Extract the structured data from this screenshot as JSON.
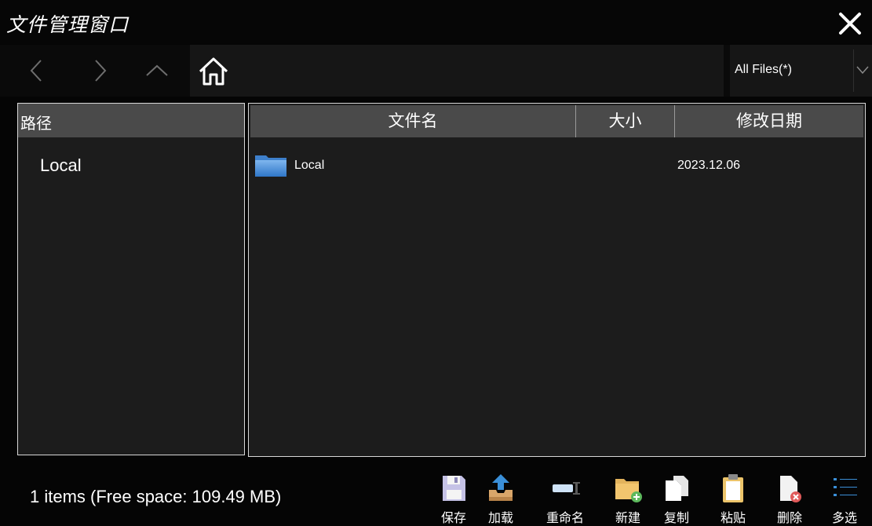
{
  "window": {
    "title": "文件管理窗口"
  },
  "nav": {
    "filter_label": "All Files(*)"
  },
  "left_pane": {
    "header": "路径",
    "items": [
      {
        "label": "Local"
      }
    ]
  },
  "file_table": {
    "columns": [
      "文件名",
      "大小",
      "修改日期"
    ],
    "rows": [
      {
        "name": "Local",
        "size": "",
        "date": "2023.12.06",
        "icon": "folder-icon"
      }
    ]
  },
  "status": {
    "text": "1 items (Free space: 109.49 MB)"
  },
  "toolbar": {
    "items": [
      {
        "label": "保存",
        "icon": "save-icon"
      },
      {
        "label": "加载",
        "icon": "load-icon"
      },
      {
        "label": "重命名",
        "icon": "rename-icon"
      },
      {
        "label": "新建",
        "icon": "new-folder-icon"
      },
      {
        "label": "复制",
        "icon": "copy-icon"
      },
      {
        "label": "粘贴",
        "icon": "paste-icon"
      },
      {
        "label": "删除",
        "icon": "delete-icon"
      },
      {
        "label": "多选",
        "icon": "multi-select-icon"
      }
    ]
  },
  "colors": {
    "background": "#050505",
    "panel": "#1c1c1c",
    "header": "#4a4a4a",
    "folder_blue": "#4a90d9"
  }
}
